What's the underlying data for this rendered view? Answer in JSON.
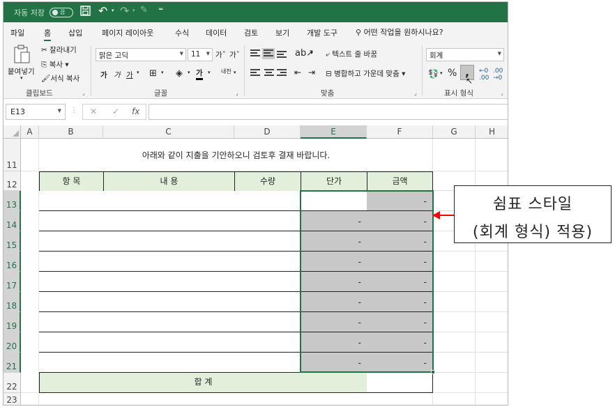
{
  "window": {
    "autosave_label": "자동 저장",
    "autosave_state": "끔"
  },
  "tabs": [
    "파일",
    "홈",
    "삽입",
    "페이지 레이아웃",
    "수식",
    "데이터",
    "검토",
    "보기",
    "개발 도구"
  ],
  "active_tab": "홈",
  "tell_me": "어떤 작업을 원하시나요?",
  "ribbon": {
    "clipboard": {
      "paste": "붙여넣기",
      "cut": "잘라내기",
      "copy": "복사",
      "format_painter": "서식 복사",
      "label": "클립보드"
    },
    "font": {
      "name": "맑은 고딕",
      "size": "11",
      "bold": "가",
      "italic": "가",
      "underline": "가",
      "label": "글꼴",
      "phonetic": "내천"
    },
    "alignment": {
      "wrap_text": "텍스트 줄 바꿈",
      "merge_center": "병합하고 가운데 맞춤",
      "label": "맞춤"
    },
    "number": {
      "format": "회계",
      "percent": "%",
      "comma": ",",
      "inc_decimal": "←.0 .00",
      "dec_decimal": ".00 →.0",
      "label": "표시 형식"
    }
  },
  "formula_bar": {
    "name_box": "E13",
    "cancel": "✕",
    "enter": "✓",
    "fx": "fx",
    "value": ""
  },
  "columns": [
    "A",
    "B",
    "C",
    "D",
    "E",
    "F",
    "G",
    "H"
  ],
  "rows": [
    "11",
    "12",
    "13",
    "14",
    "15",
    "16",
    "17",
    "18",
    "19",
    "20",
    "21",
    "22",
    "23"
  ],
  "sheet": {
    "title": "아래와 같이 지출을 기안하오니 검토후 결재 바랍니다.",
    "headers": [
      "항 목",
      "내 용",
      "수량",
      "단가",
      "금액"
    ],
    "amount_values": [
      "-",
      "-",
      "-",
      "-",
      "-",
      "-",
      "-",
      "-",
      "-"
    ],
    "unit_price_values": [
      "",
      "-",
      "-",
      "-",
      "-",
      "-",
      "-",
      "-",
      "-"
    ],
    "total_label": "합 계"
  },
  "callout": {
    "line1": "쉼표 스타일",
    "line2": "(회계 형식) 적용)"
  },
  "colors": {
    "excel_green": "#217346",
    "header_fill": "#e2efda",
    "gray_fill": "#c8c8c8",
    "arrow": "#ff0000"
  }
}
